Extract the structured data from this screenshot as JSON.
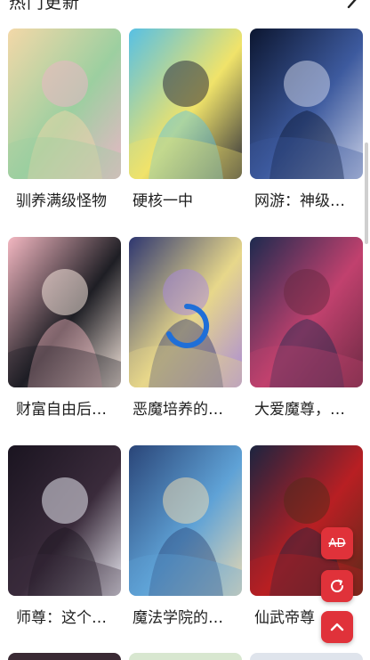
{
  "section": {
    "title": "热门更新",
    "more_icon": "chevron-right-icon"
  },
  "comics": [
    {
      "title": "驯养满级怪物",
      "palette": [
        "#f3d8a8",
        "#9ccfa0",
        "#e9b6c6"
      ]
    },
    {
      "title": "硬核一中",
      "palette": [
        "#57c0e4",
        "#f0e36a",
        "#2d2d3a"
      ]
    },
    {
      "title": "网游：神级…",
      "palette": [
        "#0c1630",
        "#3d5a9e",
        "#c9d0e6"
      ]
    },
    {
      "title": "财富自由后…",
      "palette": [
        "#f3b7c1",
        "#1e1e24",
        "#f5e6dc"
      ]
    },
    {
      "title": "恶魔培养的…",
      "palette": [
        "#2e3670",
        "#e7d78a",
        "#a98ad8"
      ]
    },
    {
      "title": "大爱魔尊，…",
      "palette": [
        "#1d2a4f",
        "#c1416e",
        "#6b2a43"
      ]
    },
    {
      "title": "师尊：这个…",
      "palette": [
        "#1a1420",
        "#3a2b3b",
        "#e8e8f0"
      ]
    },
    {
      "title": "魔法学院的…",
      "palette": [
        "#2a4578",
        "#5fa2d6",
        "#e9d9b2"
      ]
    },
    {
      "title": "仙武帝尊",
      "palette": [
        "#1b2440",
        "#b81f23",
        "#5a2a1a"
      ]
    }
  ],
  "next_row_palette": [
    "#3a2a34",
    "#d8e7d0",
    "#dfe4ec"
  ],
  "floating_buttons": {
    "ad_label": "AD",
    "refresh_icon": "refresh-icon",
    "top_icon": "chevron-up-icon"
  },
  "accent_color": "#e0323a"
}
